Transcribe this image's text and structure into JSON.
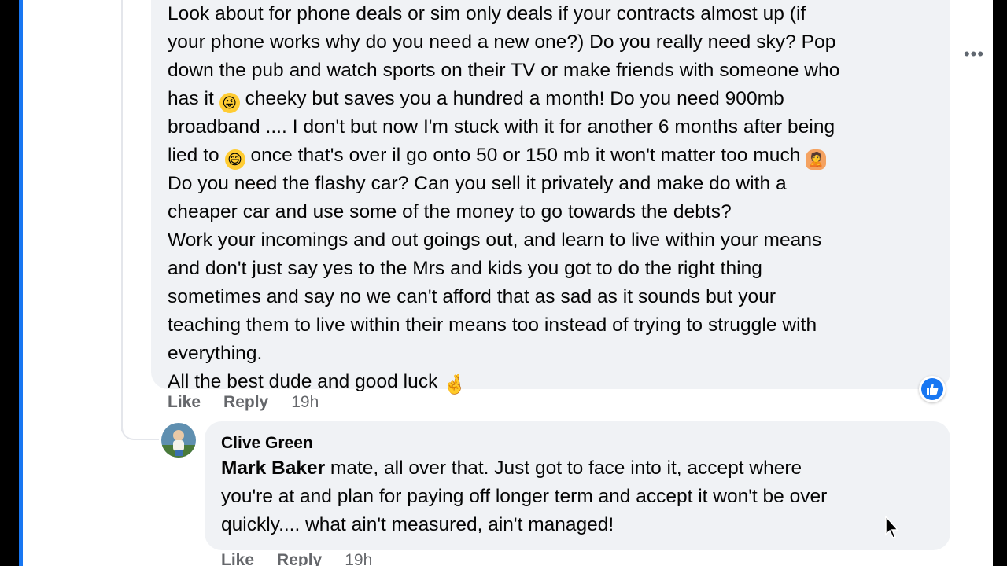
{
  "comment1": {
    "lines": [
      "Look about for phone deals or sim only deals if your contracts almost up (if",
      "your phone works why do you need a new one?) Do you really need sky? Pop",
      "down the pub and watch sports on their TV or make friends with someone who",
      "has it",
      "cheeky but saves you a hundred a month! Do you need 900mb",
      "broadband .... I don't but now I'm stuck with it for another 6 months after being",
      "lied to",
      "once that's over il go onto 50 or 150 mb it won't matter too much",
      "Do you need the flashy car? Can you sell it privately and make do with a",
      "cheaper car and use some of the money to go towards the debts?",
      "Work your incomings and out goings out, and learn to live within your means",
      "and don't just say yes to the Mrs and kids you got to do the right thing",
      "sometimes and say no we can't afford that as sad as it sounds but your",
      "teaching them to live within their means too instead of trying to struggle with",
      "everything.",
      "All the best dude and good luck"
    ],
    "emojis": {
      "wink": "😜",
      "grin": "😄",
      "person": "🙎",
      "crossed_fingers": "🤞"
    },
    "actions": {
      "like": "Like",
      "reply": "Reply",
      "time": "19h"
    },
    "reaction_icon": "like-thumb-icon"
  },
  "comment2": {
    "author": "Clive Green",
    "mention": "Mark Baker",
    "lines": [
      "mate, all over that. Just got to face into it, accept where",
      "you're at and plan for paying off longer term and accept it won't be over",
      "quickly.... what ain't measured, ain't managed!"
    ],
    "actions": {
      "like": "Like",
      "reply": "Reply",
      "time": "19h"
    }
  },
  "more_options_label": "•••",
  "colors": {
    "bubble": "#f0f2f5",
    "meta_text": "#65676b",
    "accent": "#1877f2"
  }
}
